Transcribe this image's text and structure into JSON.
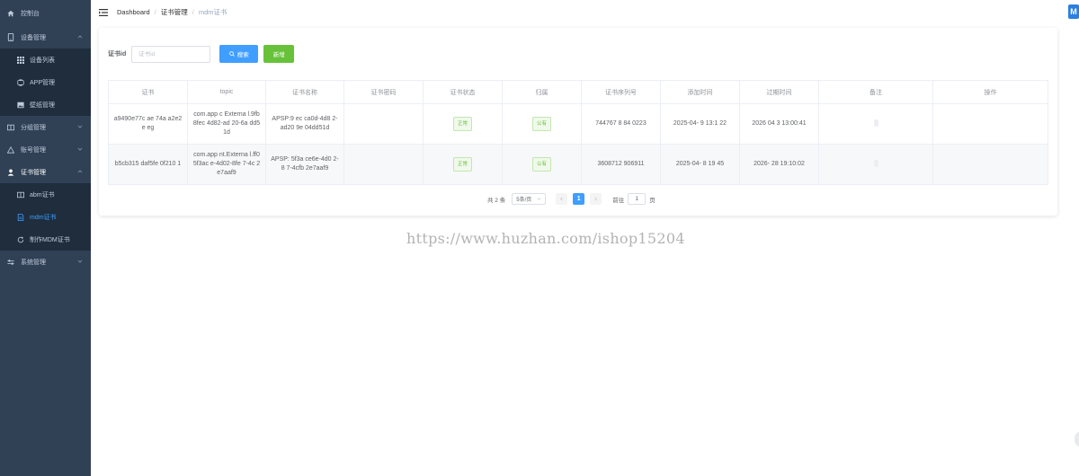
{
  "sidebar": {
    "dashboard": "控制台",
    "device_mgmt": "设备管理",
    "device_list": "设备列表",
    "app_mgmt": "APP管理",
    "wallpaper_mgmt": "壁纸管理",
    "group_mgmt": "分组管理",
    "account_mgmt": "账号管理",
    "cert_mgmt": "证书管理",
    "abm_cert": "abm证书",
    "mdm_cert": "mdm证书",
    "make_mdm_cert": "制作MDM证书",
    "system_mgmt": "系统管理",
    "active_color": "#409eff"
  },
  "breadcrumb": {
    "root": "Dashboard",
    "sep": "/",
    "parent": "证书管理",
    "current": "mdm证书"
  },
  "filter": {
    "label": "证书id",
    "placeholder": "证书id",
    "search_label": "搜索",
    "add_label": "新增"
  },
  "table": {
    "headers": [
      "证书",
      "topic",
      "证书名称",
      "证书密码",
      "证书状态",
      "归属",
      "证书序列号",
      "添加时间",
      "过期时间",
      "备注",
      "操作"
    ],
    "rows": [
      {
        "id": "a9490e77c ae 74a a2e2e eg",
        "topic": "com.app c Externa l.9fb8fec 4d82-ad 20-6a dd51d",
        "name": "APSP:9 ec ca0d-4d8 2-ad20 9e 04dd51d",
        "password": "",
        "status": "正常",
        "owner": "公有",
        "serial": "744767 8 84 0223",
        "added": "2025-04- 9 13:1 22",
        "expires": "2026 04 3 13:00:41",
        "remark": ""
      },
      {
        "id": "b5cb315 daf5fe 0f210 1",
        "topic": "com.app nt.Externa l.ff05f3ac e-4d02-8fe 7-4c 2e7aaf9",
        "name": "APSP: 5f3a ce6e-4d0 2-8 7-4cfb 2e7aaf9",
        "password": "",
        "status": "正常",
        "owner": "公有",
        "serial": "3608712 906911",
        "added": "2025-04- 8 19 45",
        "expires": "2026- 28 19:10:02",
        "remark": ""
      }
    ]
  },
  "pagination": {
    "total": "共 2 条",
    "page_size": "5条/页",
    "current_page": "1",
    "goto_label": "前往",
    "goto_value": "1",
    "page_unit": "页"
  },
  "watermark": "https://www.huzhan.com/ishop15204"
}
